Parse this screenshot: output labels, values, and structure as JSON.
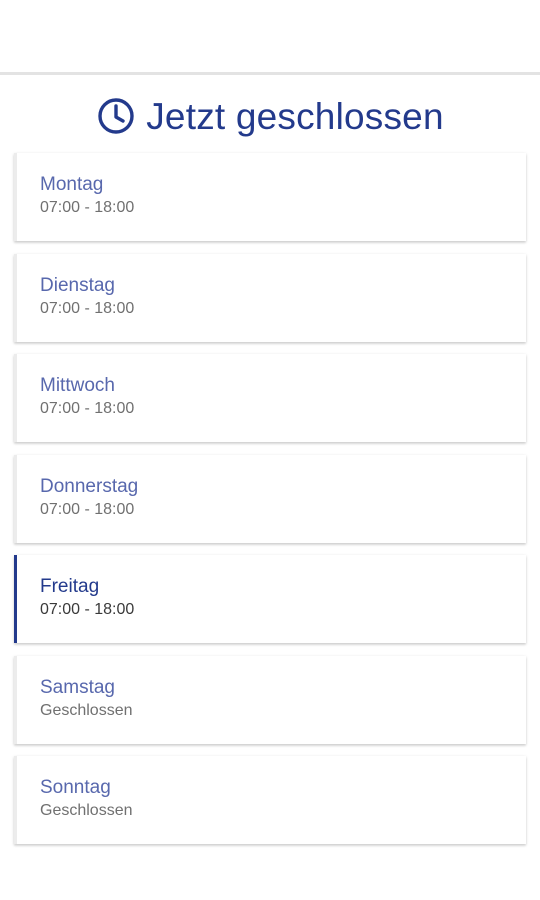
{
  "header": {
    "status_icon": "clock-icon",
    "status_text": "Jetzt geschlossen"
  },
  "colors": {
    "accent": "#233a8c",
    "day_label": "#5868ad",
    "hours_text": "#707070"
  },
  "opening_hours": [
    {
      "day": "Montag",
      "hours": "07:00 - 18:00",
      "active": false
    },
    {
      "day": "Dienstag",
      "hours": "07:00 - 18:00",
      "active": false
    },
    {
      "day": "Mittwoch",
      "hours": "07:00 - 18:00",
      "active": false
    },
    {
      "day": "Donnerstag",
      "hours": "07:00 - 18:00",
      "active": false
    },
    {
      "day": "Freitag",
      "hours": "07:00 - 18:00",
      "active": true
    },
    {
      "day": "Samstag",
      "hours": "Geschlossen",
      "active": false
    },
    {
      "day": "Sonntag",
      "hours": "Geschlossen",
      "active": false
    }
  ]
}
